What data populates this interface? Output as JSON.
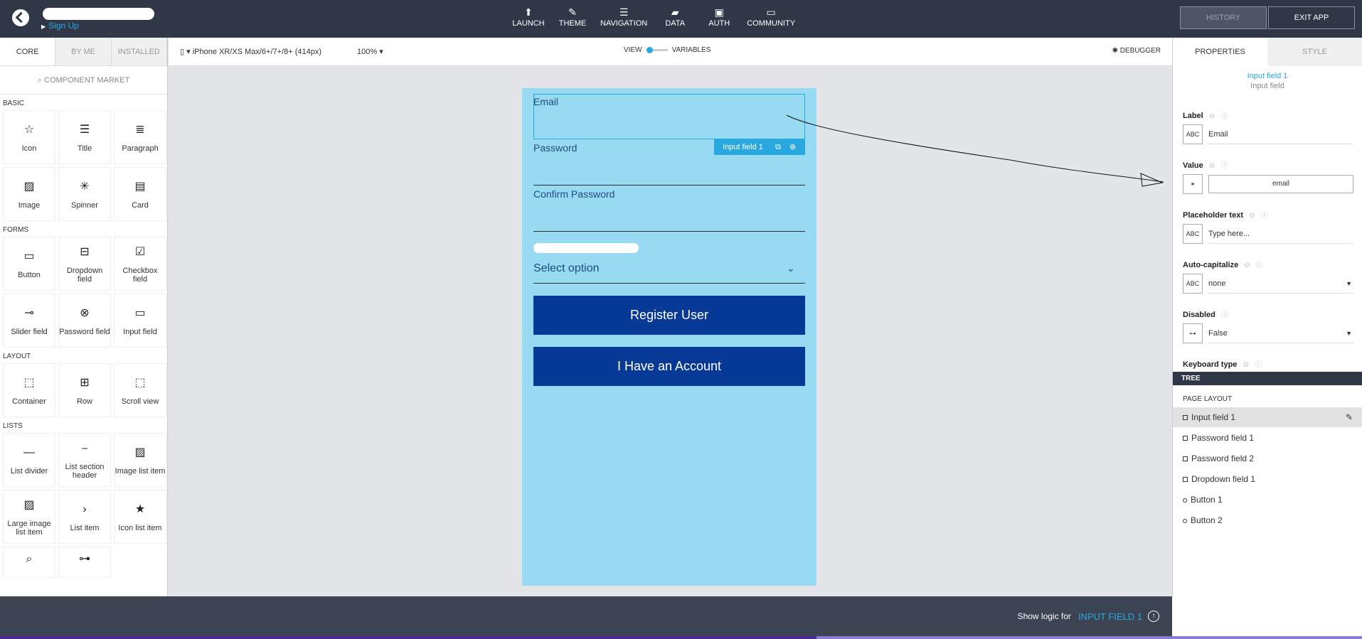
{
  "header": {
    "signup": "Sign Up",
    "nav": [
      {
        "label": "LAUNCH",
        "icon": "rocket-icon"
      },
      {
        "label": "THEME",
        "icon": "brush-icon"
      },
      {
        "label": "NAVIGATION",
        "icon": "list-icon"
      },
      {
        "label": "DATA",
        "icon": "folder-icon"
      },
      {
        "label": "AUTH",
        "icon": "lock-icon"
      },
      {
        "label": "COMMUNITY",
        "icon": "chat-icon"
      }
    ],
    "history": "HISTORY",
    "exit": "EXIT APP"
  },
  "left": {
    "tabs": [
      "CORE",
      "BY ME",
      "INSTALLED"
    ],
    "market": "COMPONENT MARKET",
    "basic_title": "BASIC",
    "basic": [
      "Icon",
      "Title",
      "Paragraph",
      "Image",
      "Spinner",
      "Card"
    ],
    "forms_title": "FORMS",
    "forms": [
      "Button",
      "Dropdown field",
      "Checkbox field",
      "Slider field",
      "Password field",
      "Input field"
    ],
    "layout_title": "LAYOUT",
    "layout": [
      "Container",
      "Row",
      "Scroll view"
    ],
    "lists_title": "LISTS",
    "lists": [
      "List divider",
      "List section header",
      "Image list item",
      "Large image list item",
      "List item",
      "Icon list item"
    ]
  },
  "toolbar": {
    "device": "iPhone XR/XS Max/6+/7+/8+ (414px)",
    "zoom": "100%",
    "view": "VIEW",
    "variables": "VARIABLES",
    "debugger": "DEBUGGER"
  },
  "screen": {
    "email_label": "Email",
    "password_label": "Password",
    "confirm_label": "Confirm Password",
    "select_placeholder": "Select option",
    "register_btn": "Register User",
    "account_btn": "I Have an Account",
    "badge": "Input field 1"
  },
  "right": {
    "tabs": [
      "PROPERTIES",
      "STYLE"
    ],
    "comp_name": "Input field 1",
    "comp_type": "Input field",
    "label_title": "Label",
    "label_value": "Email",
    "value_title": "Value",
    "value_value": "email",
    "placeholder_title": "Placeholder text",
    "placeholder_value": "Type here...",
    "autocap_title": "Auto-capitalize",
    "autocap_value": "none",
    "disabled_title": "Disabled",
    "disabled_value": "False",
    "keyboard_title": "Keyboard type",
    "tree": "TREE",
    "page_layout": "PAGE LAYOUT",
    "tree_items": [
      "Input field 1",
      "Password field 1",
      "Password field 2",
      "Dropdown field 1",
      "Button 1",
      "Button 2"
    ]
  },
  "bottom": {
    "show_logic": "Show logic for",
    "logic_target": "INPUT FIELD 1"
  }
}
